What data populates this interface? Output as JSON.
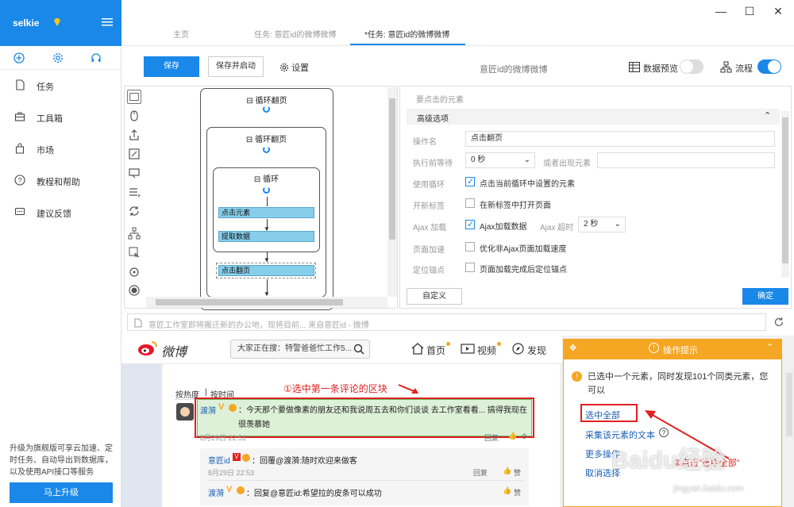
{
  "app": {
    "name": "selkie"
  },
  "sidebar": {
    "nav": [
      {
        "label": "任务",
        "icon": "document-icon"
      },
      {
        "label": "工具箱",
        "icon": "toolbox-icon"
      },
      {
        "label": "市场",
        "icon": "bag-icon"
      },
      {
        "label": "教程和帮助",
        "icon": "help-icon"
      },
      {
        "label": "建议反馈",
        "icon": "feedback-icon"
      }
    ],
    "upgrade_text": "升级为旗舰版可享云加速、定时任务、自动导出到数据库，以及使用API接口等服务",
    "upgrade_button": "马上升级"
  },
  "window": {
    "minimize": "—",
    "maximize": "☐",
    "close": "✕"
  },
  "tabs": [
    {
      "label": "主页"
    },
    {
      "label": "任务: 意匠id的微博微博"
    },
    {
      "label": "*任务: 意匠id的微博微博"
    }
  ],
  "toolbar": {
    "save": "保存",
    "save_run": "保存并启动",
    "settings": "设置",
    "workflow_title": "意匠id的微博微博",
    "data_preview": "数据预览",
    "flow": "流程"
  },
  "flow": {
    "loop_page_outer": "循环翻页",
    "loop_page_inner": "循环翻页",
    "loop": "循环",
    "click_element": "点击元素",
    "extract_data": "提取数据",
    "click_page": "点击翻页"
  },
  "config": {
    "section_top": "要点击的元素",
    "advanced": "高级选项",
    "op_name_label": "操作名",
    "op_name_value": "点击翻页",
    "wait_label": "执行前等待",
    "wait_value": "0 秒",
    "or_appear_label": "或者出现元素",
    "use_loop_label": "使用循环",
    "use_loop_text": "点击当前循环中设置的元素",
    "new_tab_label": "开新标签",
    "new_tab_text": "在新标签中打开页面",
    "ajax_label": "Ajax 加载",
    "ajax_text": "Ajax加载数据",
    "ajax_timeout_label": "Ajax  超时",
    "ajax_timeout_value": "2 秒",
    "speed_label": "页面加速",
    "speed_text": "优化非Ajax页面加载速度",
    "anchor_label": "定位锚点",
    "anchor_text": "页面加载完成后定位锚点",
    "custom_btn": "自定义",
    "ok_btn": "确定"
  },
  "urlbar": {
    "text": "意匠工作室即将搬迁新的办公地，现将目前... 来自意匠id - 微博"
  },
  "weibo": {
    "logo": "微博",
    "search": "大家正在搜：特警爸爸忙工作5...",
    "home": "首页",
    "video": "视频",
    "discover": "发现",
    "sort_hot": "按热度",
    "sort_time": "按时间",
    "annotation1": "①选中第一条评论的区块",
    "comment1_user": "渡漪",
    "comment1_text": "：今天那个要做像素的朋友还和我说周五去和你们谈谈 去工作室看看... 搞得我现在很羡慕她",
    "comment1_date": "8月29日 22:51",
    "comment1_reply": "回复",
    "comment1_likes": "9",
    "reply1_user": "意匠id",
    "reply1_text": "：回覆@渡漪:随时欢迎来做客",
    "reply1_date": "8月29日 22:53",
    "reply1_reply": "回复",
    "reply1_like": "赞",
    "reply2_user": "渡漪",
    "reply2_text": "：回复@意匠id:希望拉的皮条可以成功",
    "reply2_like": "赞"
  },
  "hint": {
    "title": "操作提示",
    "message": "已选中一个元素，同时发现101个同类元素，您可以",
    "select_all": "选中全部",
    "collect_text": "采集该元素的文本",
    "more": "更多操作",
    "cancel": "取消选择",
    "annotation2": "②点击\"选中全部\""
  },
  "watermark": {
    "brand": "Baidu经验",
    "url": "jingyan.baidu.com"
  },
  "colors": {
    "accent": "#1a88e8",
    "orange": "#f5a623",
    "red": "#e02020",
    "step": "#87ceeb"
  }
}
